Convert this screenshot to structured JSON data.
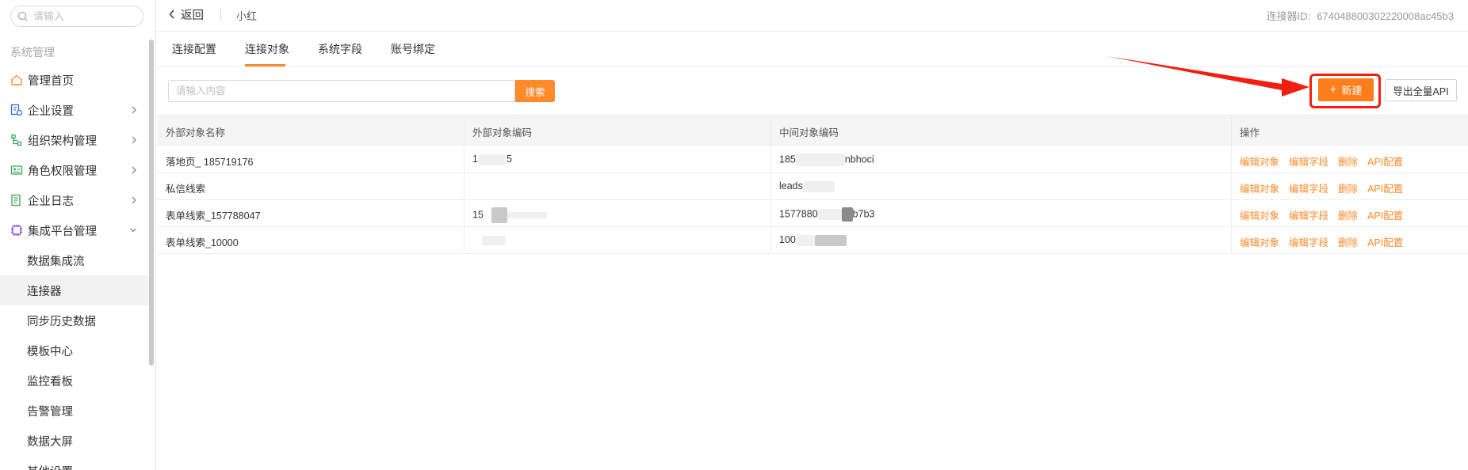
{
  "sidebar": {
    "search_placeholder": "请输入",
    "section_title": "系统管理",
    "items": [
      {
        "label": "管理首页",
        "icon": "home-icon",
        "has_chevron": false
      },
      {
        "label": "企业设置",
        "icon": "enterprise-settings-icon",
        "has_chevron": true
      },
      {
        "label": "组织架构管理",
        "icon": "org-chart-icon",
        "has_chevron": true
      },
      {
        "label": "角色权限管理",
        "icon": "id-card-icon",
        "has_chevron": true
      },
      {
        "label": "企业日志",
        "icon": "log-icon",
        "has_chevron": true
      },
      {
        "label": "集成平台管理",
        "icon": "chip-icon",
        "has_chevron": true,
        "expanded": true
      }
    ],
    "sub_items": [
      {
        "label": "数据集成流"
      },
      {
        "label": "连接器",
        "active": true
      },
      {
        "label": "同步历史数据"
      },
      {
        "label": "模板中心"
      },
      {
        "label": "监控看板"
      },
      {
        "label": "告警管理"
      },
      {
        "label": "数据大屏"
      },
      {
        "label": "其他设置"
      }
    ]
  },
  "header": {
    "back_label": "返回",
    "connector_name": "小红",
    "connector_id_label": "连接器ID:",
    "connector_id_value": "674048800302220008ac45b3"
  },
  "tabs": [
    {
      "label": "连接配置",
      "active": false
    },
    {
      "label": "连接对象",
      "active": true
    },
    {
      "label": "系统字段",
      "active": false
    },
    {
      "label": "账号绑定",
      "active": false
    }
  ],
  "toolbar": {
    "search_placeholder": "请输入内容",
    "search_button": "搜索",
    "new_button": "新建",
    "export_button": "导出全量API"
  },
  "table": {
    "columns": [
      "外部对象名称",
      "外部对象编码",
      "中间对象编码",
      "操作"
    ],
    "rows": [
      {
        "name": "落地页_ 185719176",
        "ext_code": "1",
        "ext_code_tail": "5",
        "mid_code": "185",
        "mid_code_tail": "nbhoci"
      },
      {
        "name": "私信线索",
        "ext_code": "",
        "ext_code_tail": "",
        "mid_code": "leads",
        "mid_code_tail": ""
      },
      {
        "name": "表单线索_157788047",
        "ext_code": "15",
        "ext_code_tail": "",
        "mid_code": "1577880",
        "mid_code_tail": "b7b3"
      },
      {
        "name": "表单线索_10000",
        "ext_code": "",
        "ext_code_tail": "",
        "mid_code": "100",
        "mid_code_tail": ""
      }
    ],
    "operations": [
      "编辑对象",
      "编辑字段",
      "删除",
      "API配置"
    ]
  },
  "colors": {
    "accent": "#ff8a2a",
    "highlight": "#f21f10"
  }
}
